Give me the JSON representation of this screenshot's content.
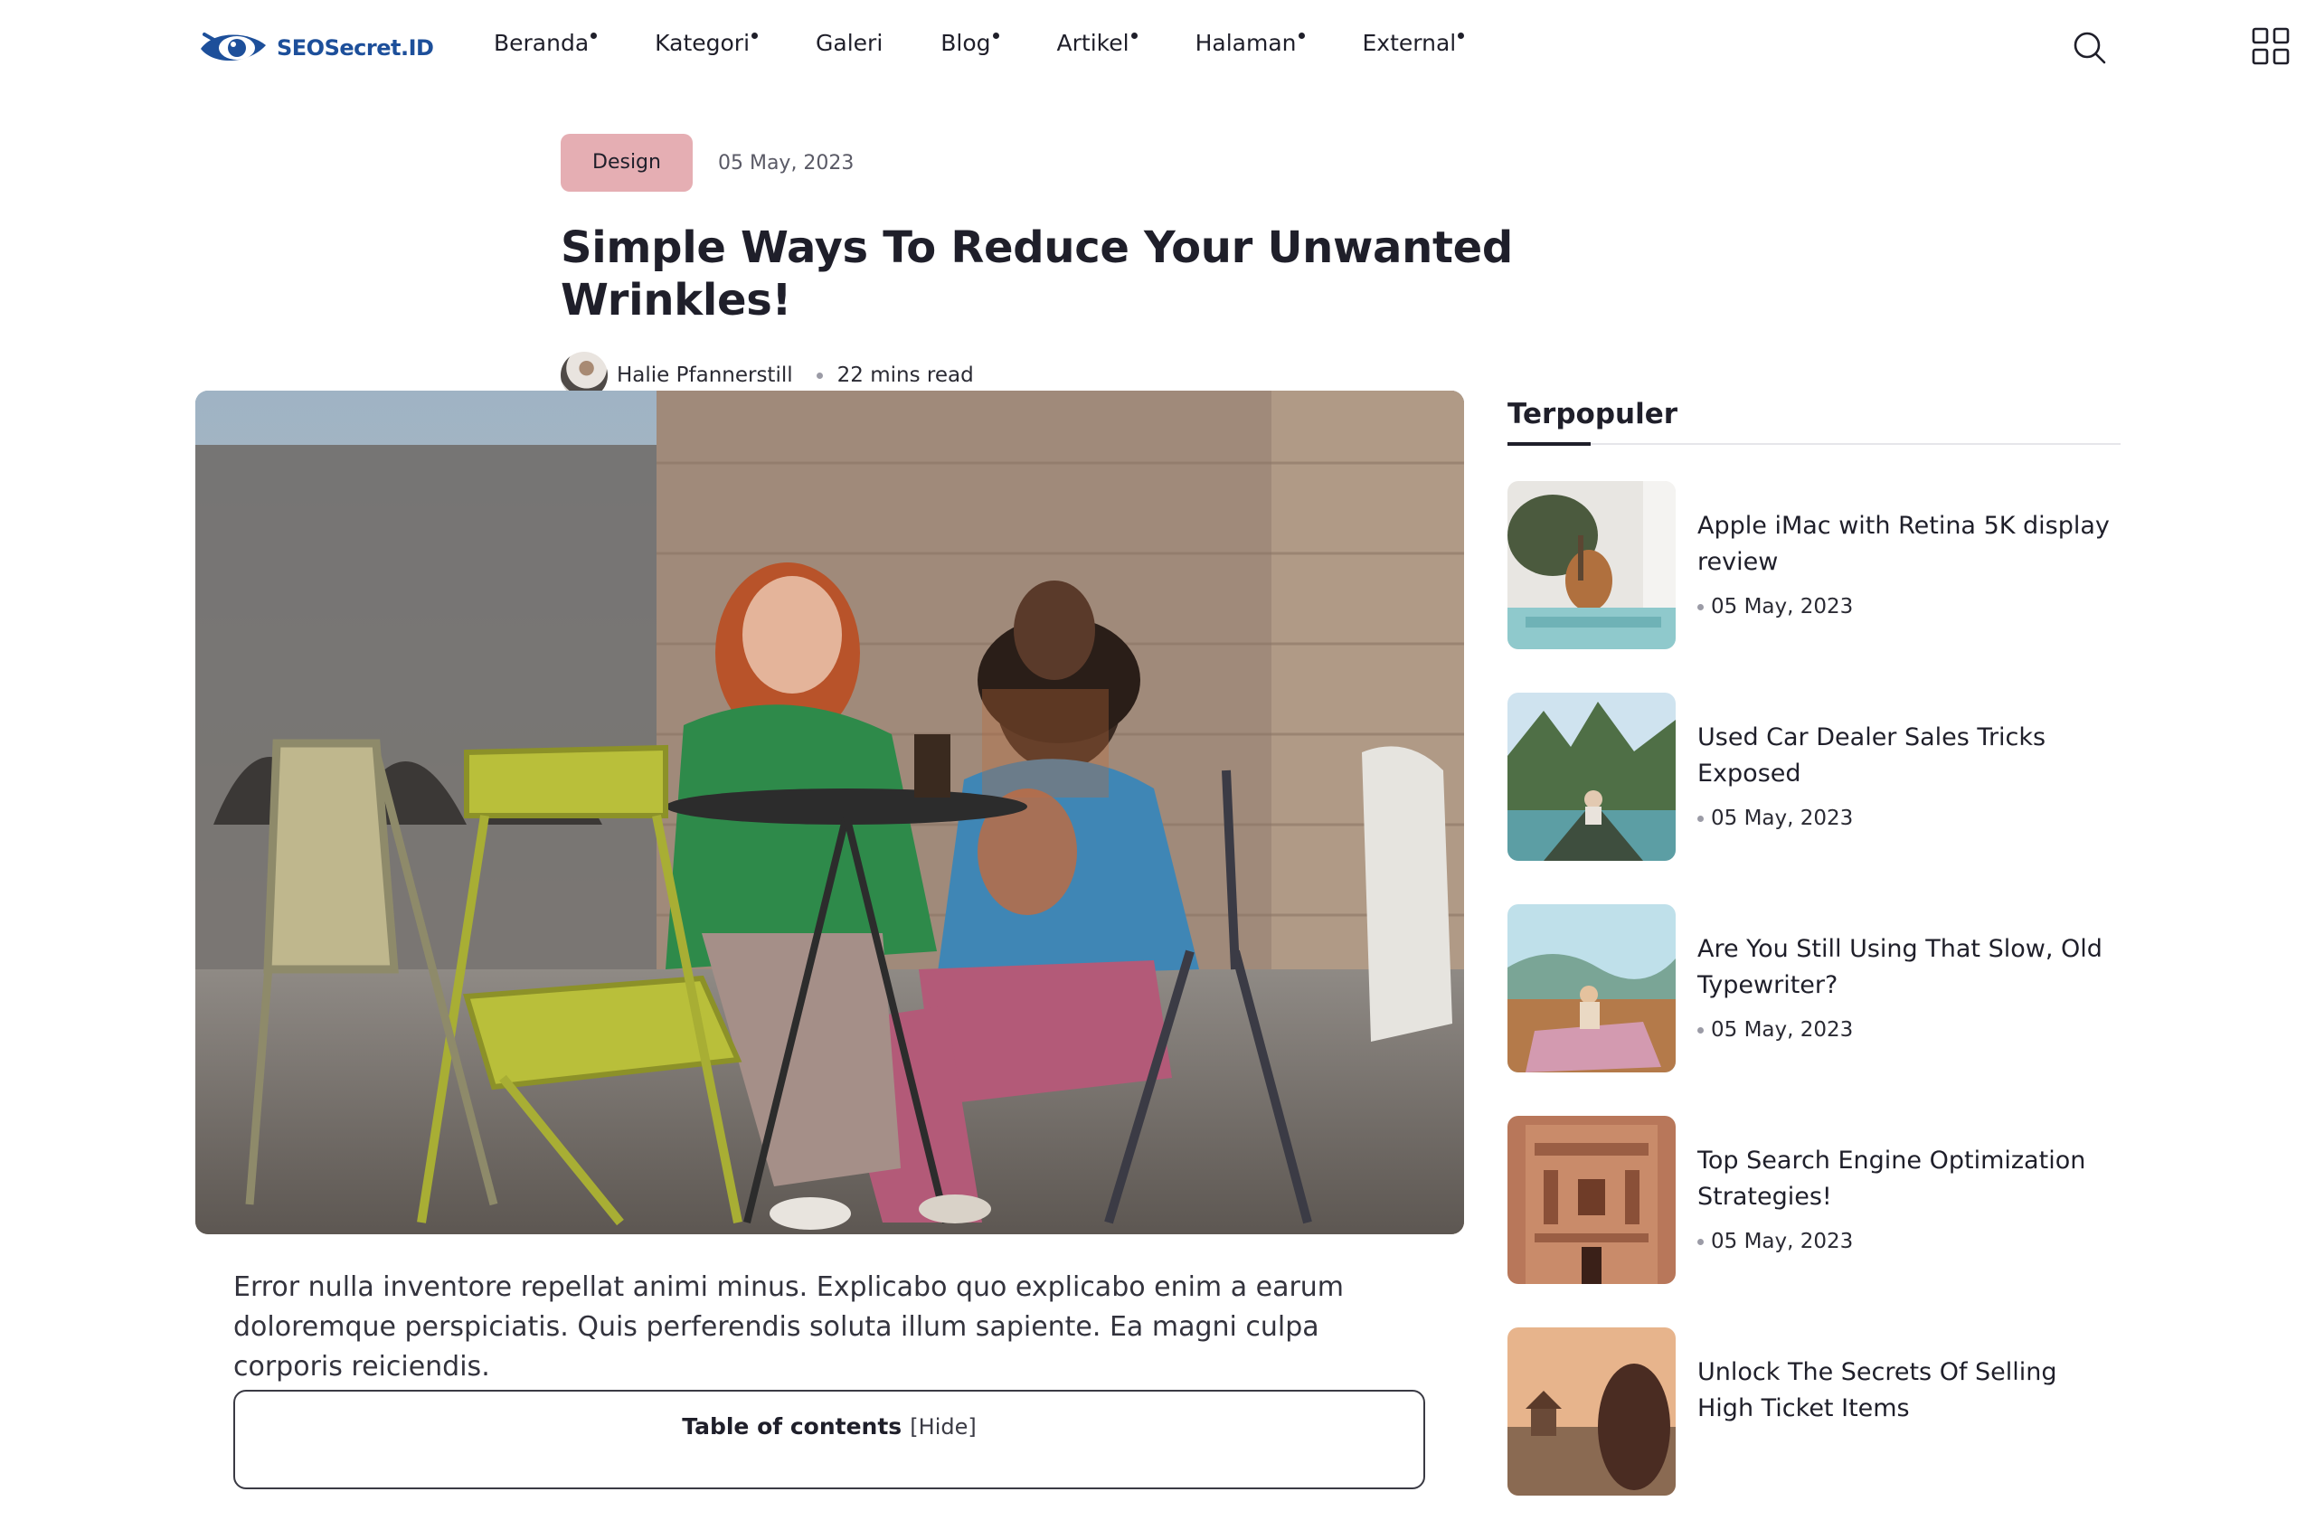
{
  "brand": {
    "name": "SEOSecret.ID",
    "color": "#1d4f9a"
  },
  "nav": {
    "items": [
      {
        "label": "Beranda",
        "has_dropdown": true
      },
      {
        "label": "Kategori",
        "has_dropdown": true
      },
      {
        "label": "Galeri",
        "has_dropdown": false
      },
      {
        "label": "Blog",
        "has_dropdown": true
      },
      {
        "label": "Artikel",
        "has_dropdown": true
      },
      {
        "label": "Halaman",
        "has_dropdown": true
      },
      {
        "label": "External",
        "has_dropdown": true
      }
    ],
    "search_icon": "search-icon",
    "menu_icon": "grid-icon"
  },
  "article": {
    "category": "Design",
    "category_color": "#e5aeb3",
    "date": "05 May, 2023",
    "title": "Simple Ways To Reduce Your Unwanted Wrinkles!",
    "author": "Halie Pfannerstill",
    "read_time": "22 mins read",
    "intro": "Error nulla inventore repellat animi minus. Explicabo quo explicabo enim a earum doloremque perspiciatis. Quis perferendis soluta illum sapiente. Ea magni culpa corporis reiciendis."
  },
  "toc": {
    "title": "Table of contents",
    "toggle": "[Hide]"
  },
  "sidebar": {
    "title": "Terpopuler",
    "posts": [
      {
        "title": "Apple iMac with Retina 5K display review",
        "date": "05 May, 2023"
      },
      {
        "title": "Used Car Dealer Sales Tricks Exposed",
        "date": "05 May, 2023"
      },
      {
        "title": "Are You Still Using That Slow, Old Typewriter?",
        "date": "05 May, 2023"
      },
      {
        "title": "Top Search Engine Optimization Strategies!",
        "date": "05 May, 2023"
      },
      {
        "title": "Unlock The Secrets Of Selling High Ticket Items",
        "date": ""
      }
    ]
  }
}
